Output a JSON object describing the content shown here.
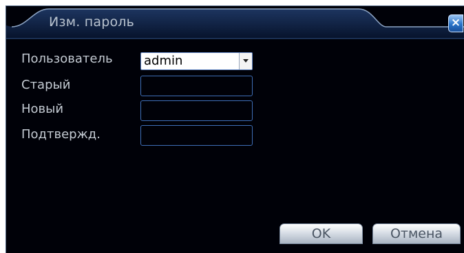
{
  "dialog": {
    "title": "Изм. пароль",
    "close_label": "×"
  },
  "form": {
    "user_label": "Пользователь",
    "user_value": "admin",
    "old_label": "Старый",
    "new_label": "Новый",
    "confirm_label": "Подтвержд."
  },
  "buttons": {
    "ok": "OK",
    "cancel": "Отмена"
  },
  "colors": {
    "background": "#000108",
    "title_tab": "#0c1e3c",
    "field_border": "#3f6fb8"
  }
}
